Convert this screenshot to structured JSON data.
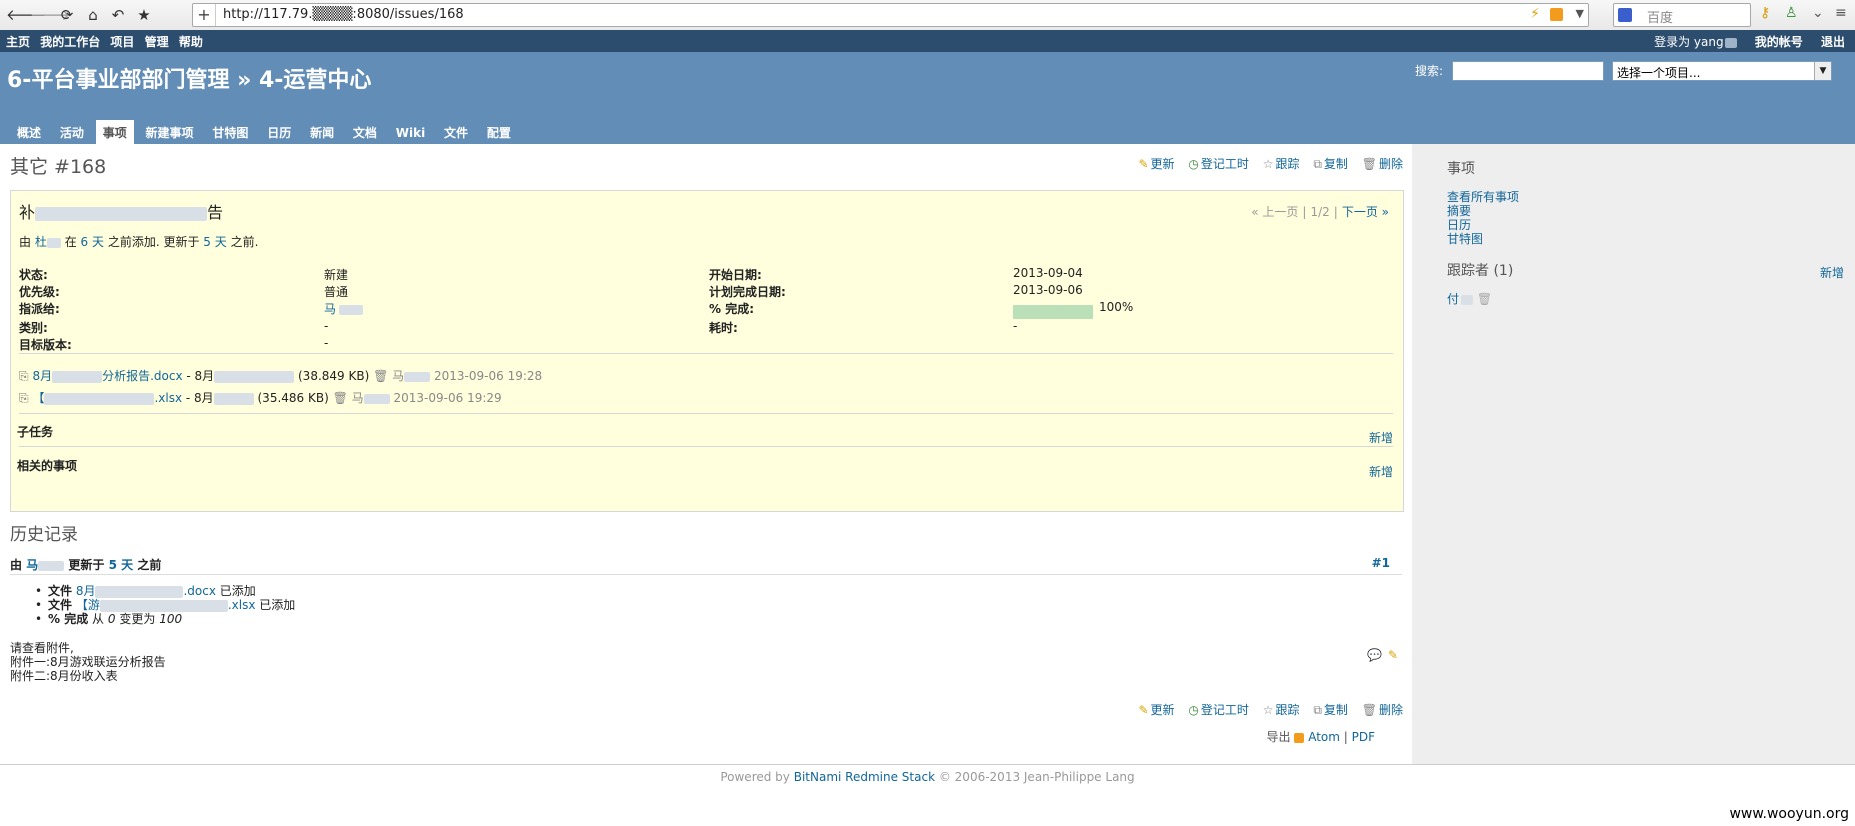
{
  "browser": {
    "url": "http://117.79.▒▒▒▒:8080/issues/168",
    "search_placeholder": "百度",
    "plus": "+"
  },
  "topmenu": {
    "left": [
      "主页",
      "我的工作台",
      "项目",
      "管理",
      "帮助"
    ],
    "logged_in": "登录为 yang",
    "my_account": "我的帐号",
    "logout": "退出"
  },
  "header": {
    "project_title": "6-平台事业部部门管理 » 4-运营中心",
    "search_label": "搜索:",
    "project_select": "选择一个项目..."
  },
  "tabs": [
    "概述",
    "活动",
    "事项",
    "新建事项",
    "甘特图",
    "日历",
    "新闻",
    "文档",
    "Wiki",
    "文件",
    "配置"
  ],
  "selected_tab": "事项",
  "issue": {
    "heading": "其它 #168",
    "actions": {
      "update": "更新",
      "log_time": "登记工时",
      "watch": "跟踪",
      "copy": "复制",
      "delete": "删除"
    },
    "subject_start": "补",
    "subject_end": "告",
    "pager": {
      "prev": "« 上一页",
      "count": "1/2",
      "next": "下一页 »"
    },
    "author_by": "由",
    "author_name": "杜",
    "author_in": "在",
    "added_ago": "6 天",
    "added_text": "之前添加. 更新于",
    "updated_ago": "5 天",
    "updated_text": "之前.",
    "attrs": {
      "status_l": "状态:",
      "status_v": "新建",
      "priority_l": "优先级:",
      "priority_v": "普通",
      "assignee_l": "指派给:",
      "assignee_v": "马",
      "category_l": "类别:",
      "category_v": "-",
      "version_l": "目标版本:",
      "version_v": "-",
      "start_l": "开始日期:",
      "start_v": "2013-09-04",
      "due_l": "计划完成日期:",
      "due_v": "2013-09-06",
      "done_l": "% 完成:",
      "done_v": "100%",
      "spent_l": "耗时:",
      "spent_v": "-"
    },
    "done_ratio": 100,
    "attachments": [
      {
        "name_a": "8月",
        "name_b": "分析报告.docx",
        "desc": "- 8月",
        "size": "(38.849 KB)",
        "user": "马",
        "date": "2013-09-06 19:28"
      },
      {
        "name_a": "【",
        "name_b": ".xlsx",
        "desc": "- 8月",
        "size": "(35.486 KB)",
        "user": "马",
        "date": "2013-09-06 19:29"
      }
    ],
    "subtasks": "子任务",
    "related": "相关的事项",
    "new": "新增"
  },
  "history": {
    "title": "历史记录",
    "journal_by": "由",
    "journal_user": "马",
    "journal_upd": "更新于",
    "journal_ago": "5 天",
    "journal_before": "之前",
    "journal_num": "#1",
    "d1_label": "文件",
    "d1_a": "8月",
    "d1_b": ".docx",
    "d1_added": "已添加",
    "d2_label": "文件",
    "d2_a": "【游",
    "d2_b": ".xlsx",
    "d2_added": "已添加",
    "d3_label": "% 完成",
    "d3_from": "从",
    "d3_old": "0",
    "d3_to": "变更为",
    "d3_new": "100",
    "notes": [
      "请查看附件,",
      "附件一:8月游戏联运分析报告",
      "附件二:8月份收入表"
    ]
  },
  "export": {
    "label": "导出",
    "atom": "Atom",
    "pdf": "PDF"
  },
  "footer": {
    "powered": "Powered by",
    "stack": "BitNami Redmine Stack",
    "copy": "© 2006-2013 Jean-Philippe Lang"
  },
  "sidebar": {
    "issues_title": "事项",
    "links": [
      "查看所有事项",
      "摘要",
      "日历",
      "甘特图"
    ],
    "watchers_title": "跟踪者 (1)",
    "watchers_new": "新增",
    "watcher": "付"
  },
  "watermark": "www.wooyun.org"
}
